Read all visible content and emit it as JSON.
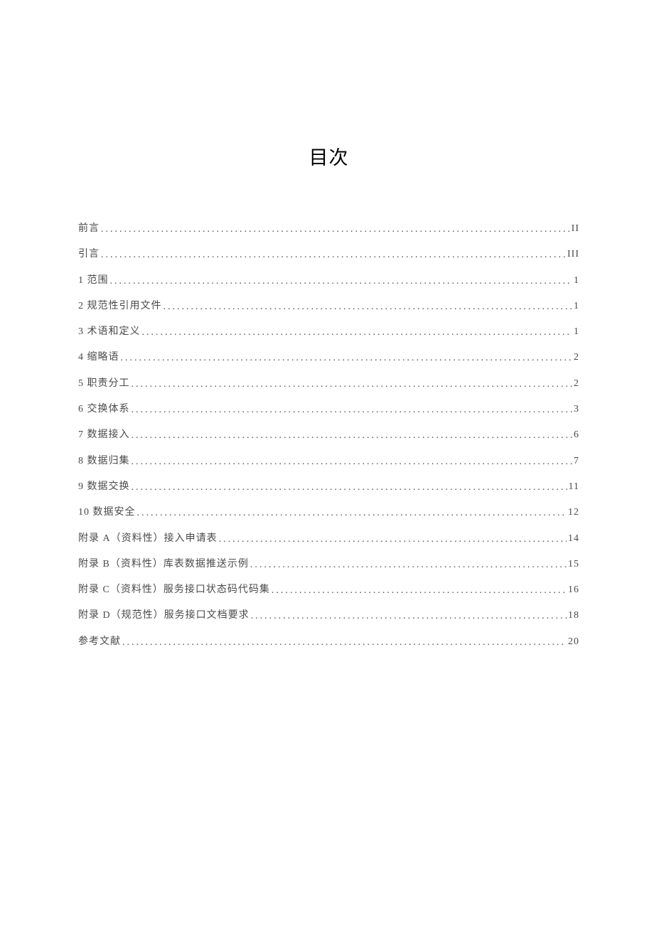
{
  "title": "目次",
  "entries": [
    {
      "label": "前言",
      "page": "II"
    },
    {
      "label": "引言",
      "page": "III"
    },
    {
      "label": "1 范围",
      "page": "1"
    },
    {
      "label": "2 规范性引用文件",
      "page": "1"
    },
    {
      "label": "3 术语和定义",
      "page": "1"
    },
    {
      "label": "4 缩略语",
      "page": "2"
    },
    {
      "label": "5 职责分工",
      "page": "2"
    },
    {
      "label": "6 交换体系",
      "page": "3"
    },
    {
      "label": "7 数据接入",
      "page": "6"
    },
    {
      "label": "8 数据归集",
      "page": "7"
    },
    {
      "label": "9 数据交换",
      "page": "11"
    },
    {
      "label": "10 数据安全",
      "page": "12"
    },
    {
      "label": "附录 A（资料性）接入申请表",
      "page": "14"
    },
    {
      "label": "附录 B（资料性）库表数据推送示例",
      "page": "15"
    },
    {
      "label": "附录 C（资料性）服务接口状态码代码集",
      "page": "16"
    },
    {
      "label": "附录 D（规范性）服务接口文档要求",
      "page": "18"
    },
    {
      "label": "参考文献",
      "page": "20"
    }
  ]
}
